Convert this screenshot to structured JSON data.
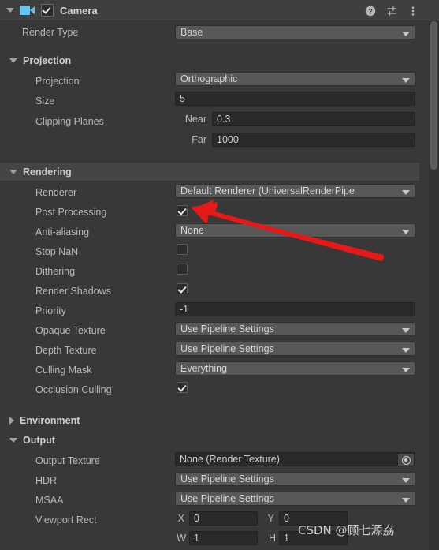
{
  "header": {
    "component_name": "Camera",
    "enabled": true,
    "foldout_open": true,
    "icons": [
      {
        "name": "help-icon",
        "glyph": "?"
      },
      {
        "name": "preset-icon",
        "glyph": "preset"
      },
      {
        "name": "more-menu-icon",
        "glyph": "⋮"
      }
    ]
  },
  "accent": {
    "camera_icon": "#5ec8f2",
    "arrow": "#e61919",
    "panel_bg": "#383838",
    "field_bg": "#2a2a2a",
    "popup_bg": "#585858"
  },
  "rows": {
    "render_type": {
      "label": "Render Type",
      "value": "Base"
    },
    "projection_section": "Projection",
    "projection": {
      "label": "Projection",
      "value": "Orthographic"
    },
    "size": {
      "label": "Size",
      "value": "5"
    },
    "clipping_planes": {
      "label": "Clipping Planes",
      "near_label": "Near",
      "near": "0.3",
      "far_label": "Far",
      "far": "1000"
    },
    "rendering_section": "Rendering",
    "renderer": {
      "label": "Renderer",
      "value": "Default Renderer (UniversalRenderPipe"
    },
    "post_processing": {
      "label": "Post Processing",
      "checked": true
    },
    "anti_aliasing": {
      "label": "Anti-aliasing",
      "value": "None"
    },
    "stop_nan": {
      "label": "Stop NaN",
      "checked": false
    },
    "dithering": {
      "label": "Dithering",
      "checked": false
    },
    "render_shadows": {
      "label": "Render Shadows",
      "checked": true
    },
    "priority": {
      "label": "Priority",
      "value": "-1"
    },
    "opaque_texture": {
      "label": "Opaque Texture",
      "value": "Use Pipeline Settings"
    },
    "depth_texture": {
      "label": "Depth Texture",
      "value": "Use Pipeline Settings"
    },
    "culling_mask": {
      "label": "Culling Mask",
      "value": "Everything"
    },
    "occlusion_culling": {
      "label": "Occlusion Culling",
      "checked": true
    },
    "environment_section": "Environment",
    "output_section": "Output",
    "output_texture": {
      "label": "Output Texture",
      "value": "None (Render Texture)"
    },
    "hdr": {
      "label": "HDR",
      "value": "Use Pipeline Settings"
    },
    "msaa": {
      "label": "MSAA",
      "value": "Use Pipeline Settings"
    },
    "viewport_rect": {
      "label": "Viewport Rect",
      "x_label": "X",
      "x": "0",
      "y_label": "Y",
      "y": "0",
      "w_label": "W",
      "w": "1",
      "h_label": "H",
      "h": "1"
    }
  },
  "watermark": {
    "text": "CSDN @顾七源劦"
  }
}
